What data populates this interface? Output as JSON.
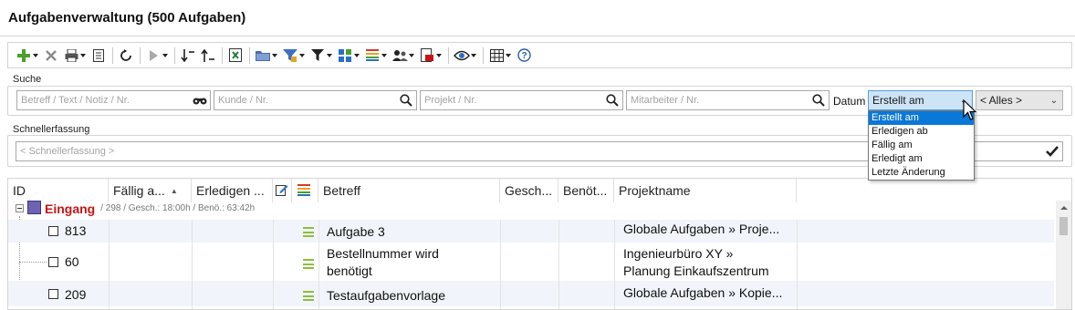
{
  "window": {
    "title": "Aufgabenverwaltung (500 Aufgaben)"
  },
  "toolbar": {
    "icons": [
      "add-icon",
      "delete-icon",
      "print-icon",
      "export-icon",
      "refresh-icon",
      "run-icon",
      "sort-desc-icon",
      "sort-asc-icon",
      "excel-icon",
      "folder-icon",
      "funnel-color-icon",
      "filter-icon",
      "apps-icon",
      "colors-icon",
      "users-icon",
      "pdf-icon",
      "eye-icon",
      "grid-icon",
      "help-icon"
    ]
  },
  "search": {
    "label": "Suche",
    "betreff_placeholder": "Betreff / Text / Notiz / Nr.",
    "kunde_placeholder": "Kunde / Nr.",
    "projekt_placeholder": "Projekt / Nr.",
    "mitarbeiter_placeholder": "Mitarbeiter / Nr.",
    "datum_label": "Datum",
    "datum_selected": "Erstellt am",
    "range_selected": "< Alles >",
    "datum_options": [
      "Erstellt am",
      "Erledigen ab",
      "Fällig am",
      "Erledigt am",
      "Letzte Änderung"
    ]
  },
  "quick_entry": {
    "label": "Schnellerfassung",
    "placeholder": "< Schnellerfassung >"
  },
  "table": {
    "columns": {
      "id": "ID",
      "faellig": "Fällig a...",
      "erledigen": "Erledigen ...",
      "betreff": "Betreff",
      "gesch": "Gesch...",
      "benoet": "Benöt...",
      "projektname": "Projektname"
    },
    "group": {
      "name": "Eingang",
      "summary": "/ 298 / Gesch.: 18:00h / Benö.: 63:42h"
    },
    "rows": [
      {
        "id": "813",
        "betreff": "Aufgabe 3",
        "projekt": "Globale Aufgaben » Proje..."
      },
      {
        "id": "60",
        "betreff_line1": "Bestellnummer wird",
        "betreff_line2": "benötigt",
        "projekt_line1": "Ingenieurbüro XY  »",
        "projekt_line2": "Planung Einkaufszentrum"
      },
      {
        "id": "209",
        "betreff": "Testaufgabenvorlage",
        "projekt": "Globale Aufgaben » Kopie..."
      }
    ]
  },
  "colors": {
    "accent": "#0a78d7",
    "group": "#c81414",
    "priority": "#8cbf3f"
  }
}
